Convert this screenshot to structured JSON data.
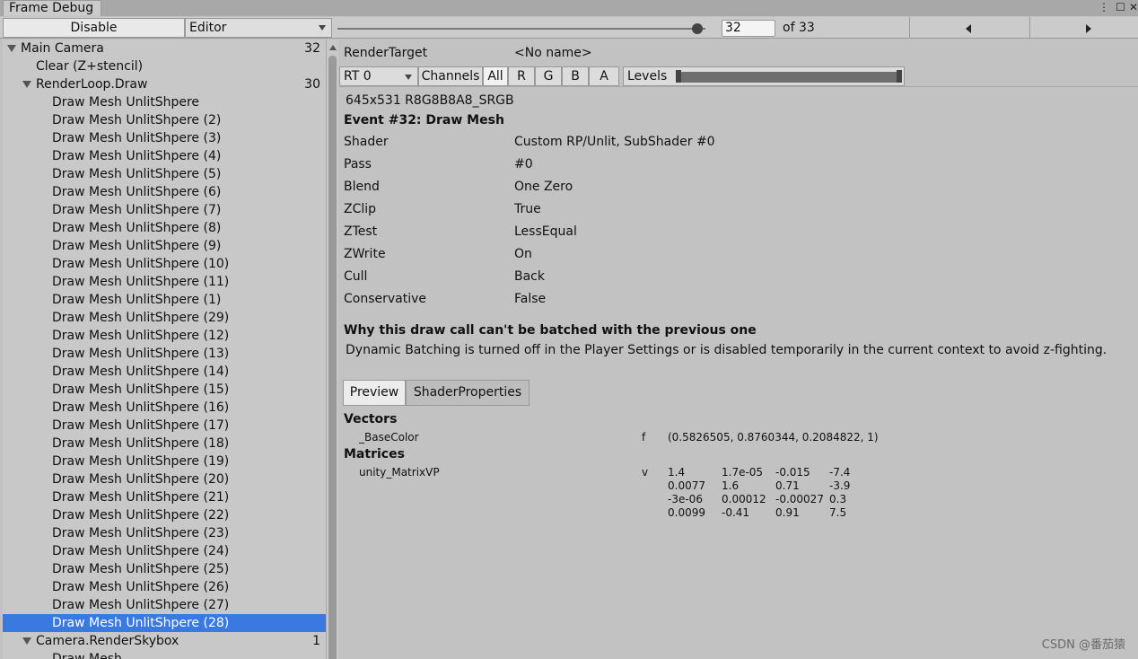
{
  "window": {
    "tab_title": "Frame Debug"
  },
  "toolbar": {
    "disable_label": "Disable",
    "editor_label": "Editor",
    "event_index": "32",
    "of_count": "of 33"
  },
  "tree": {
    "rows": [
      {
        "label": "Main Camera",
        "count": "32",
        "level": 0,
        "fold": true
      },
      {
        "label": "Clear (Z+stencil)",
        "count": "",
        "level": 1,
        "fold": false
      },
      {
        "label": "RenderLoop.Draw",
        "count": "30",
        "level": 1,
        "fold": true
      },
      {
        "label": "Draw Mesh UnlitShpere",
        "count": "",
        "level": 2,
        "fold": false
      },
      {
        "label": "Draw Mesh UnlitShpere (2)",
        "count": "",
        "level": 2,
        "fold": false
      },
      {
        "label": "Draw Mesh UnlitShpere (3)",
        "count": "",
        "level": 2,
        "fold": false
      },
      {
        "label": "Draw Mesh UnlitShpere (4)",
        "count": "",
        "level": 2,
        "fold": false
      },
      {
        "label": "Draw Mesh UnlitShpere (5)",
        "count": "",
        "level": 2,
        "fold": false
      },
      {
        "label": "Draw Mesh UnlitShpere (6)",
        "count": "",
        "level": 2,
        "fold": false
      },
      {
        "label": "Draw Mesh UnlitShpere (7)",
        "count": "",
        "level": 2,
        "fold": false
      },
      {
        "label": "Draw Mesh UnlitShpere (8)",
        "count": "",
        "level": 2,
        "fold": false
      },
      {
        "label": "Draw Mesh UnlitShpere (9)",
        "count": "",
        "level": 2,
        "fold": false
      },
      {
        "label": "Draw Mesh UnlitShpere (10)",
        "count": "",
        "level": 2,
        "fold": false
      },
      {
        "label": "Draw Mesh UnlitShpere (11)",
        "count": "",
        "level": 2,
        "fold": false
      },
      {
        "label": "Draw Mesh UnlitShpere (1)",
        "count": "",
        "level": 2,
        "fold": false
      },
      {
        "label": "Draw Mesh UnlitShpere (29)",
        "count": "",
        "level": 2,
        "fold": false
      },
      {
        "label": "Draw Mesh UnlitShpere (12)",
        "count": "",
        "level": 2,
        "fold": false
      },
      {
        "label": "Draw Mesh UnlitShpere (13)",
        "count": "",
        "level": 2,
        "fold": false
      },
      {
        "label": "Draw Mesh UnlitShpere (14)",
        "count": "",
        "level": 2,
        "fold": false
      },
      {
        "label": "Draw Mesh UnlitShpere (15)",
        "count": "",
        "level": 2,
        "fold": false
      },
      {
        "label": "Draw Mesh UnlitShpere (16)",
        "count": "",
        "level": 2,
        "fold": false
      },
      {
        "label": "Draw Mesh UnlitShpere (17)",
        "count": "",
        "level": 2,
        "fold": false
      },
      {
        "label": "Draw Mesh UnlitShpere (18)",
        "count": "",
        "level": 2,
        "fold": false
      },
      {
        "label": "Draw Mesh UnlitShpere (19)",
        "count": "",
        "level": 2,
        "fold": false
      },
      {
        "label": "Draw Mesh UnlitShpere (20)",
        "count": "",
        "level": 2,
        "fold": false
      },
      {
        "label": "Draw Mesh UnlitShpere (21)",
        "count": "",
        "level": 2,
        "fold": false
      },
      {
        "label": "Draw Mesh UnlitShpere (22)",
        "count": "",
        "level": 2,
        "fold": false
      },
      {
        "label": "Draw Mesh UnlitShpere (23)",
        "count": "",
        "level": 2,
        "fold": false
      },
      {
        "label": "Draw Mesh UnlitShpere (24)",
        "count": "",
        "level": 2,
        "fold": false
      },
      {
        "label": "Draw Mesh UnlitShpere (25)",
        "count": "",
        "level": 2,
        "fold": false
      },
      {
        "label": "Draw Mesh UnlitShpere (26)",
        "count": "",
        "level": 2,
        "fold": false
      },
      {
        "label": "Draw Mesh UnlitShpere (27)",
        "count": "",
        "level": 2,
        "fold": false
      },
      {
        "label": "Draw Mesh UnlitShpere (28)",
        "count": "",
        "level": 2,
        "fold": false,
        "selected": true
      },
      {
        "label": "Camera.RenderSkybox",
        "count": "1",
        "level": 1,
        "fold": true
      },
      {
        "label": "Draw Mesh",
        "count": "",
        "level": 2,
        "fold": false
      }
    ]
  },
  "details": {
    "render_target_label": "RenderTarget",
    "render_target_value": "<No name>",
    "rt_select": "RT 0",
    "channels_label": "Channels",
    "channels": [
      "All",
      "R",
      "G",
      "B",
      "A"
    ],
    "levels_label": "Levels",
    "format": "645x531 R8G8B8A8_SRGB",
    "event_title": "Event #32: Draw Mesh",
    "props": [
      {
        "k": "Shader",
        "v": "Custom RP/Unlit, SubShader #0"
      },
      {
        "k": "Pass",
        "v": "#0"
      },
      {
        "k": "Blend",
        "v": "One Zero"
      },
      {
        "k": "ZClip",
        "v": "True"
      },
      {
        "k": "ZTest",
        "v": "LessEqual"
      },
      {
        "k": "ZWrite",
        "v": "On"
      },
      {
        "k": "Cull",
        "v": "Back"
      },
      {
        "k": "Conservative",
        "v": "False"
      }
    ],
    "batch_title": "Why this draw call can't be batched with the previous one",
    "batch_reason": "Dynamic Batching is turned off in the Player Settings or is disabled temporarily in the current context to avoid z-fighting.",
    "tabs": [
      "Preview",
      "ShaderProperties"
    ],
    "vectors_title": "Vectors",
    "vector": {
      "name": "_BaseColor",
      "type": "f",
      "value": "(0.5826505, 0.8760344, 0.2084822, 1)"
    },
    "matrices_title": "Matrices",
    "matrix": {
      "name": "unity_MatrixVP",
      "type": "v",
      "rows": [
        [
          "1.4",
          "1.7e-05",
          "-0.015",
          "-7.4"
        ],
        [
          "0.0077",
          "1.6",
          "0.71",
          "-3.9"
        ],
        [
          "-3e-06",
          "0.00012",
          "-0.00027",
          "0.3"
        ],
        [
          "0.0099",
          "-0.41",
          "0.91",
          "7.5"
        ]
      ]
    }
  },
  "watermark": "CSDN @番茄猿",
  "colors": {
    "selection": "#3a7ae0",
    "panel": "#c2c2c2"
  }
}
